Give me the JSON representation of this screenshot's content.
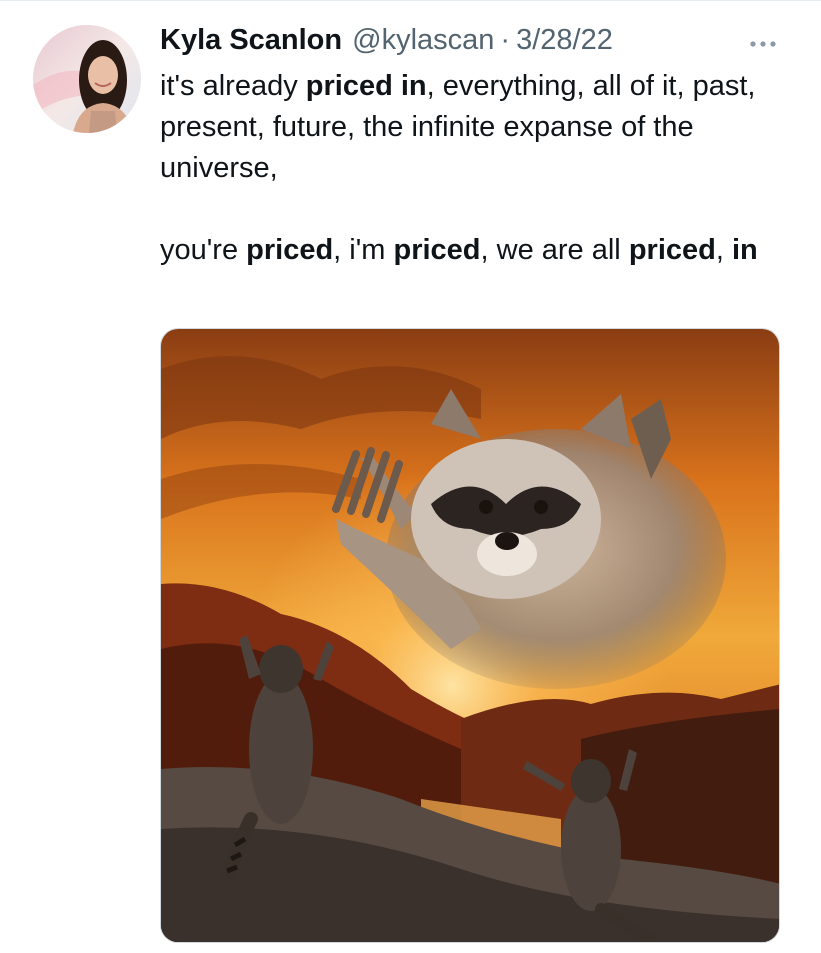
{
  "tweet": {
    "author_name": "Kyla Scanlon",
    "handle": "@kylascan",
    "separator": "·",
    "date": "3/28/22",
    "text_parts": [
      {
        "text": "it's already ",
        "bold": false
      },
      {
        "text": "priced in",
        "bold": true
      },
      {
        "text": ", everything, all of it, past, present, future, the infinite expanse of the universe,\n\nyou're ",
        "bold": false
      },
      {
        "text": "priced",
        "bold": true
      },
      {
        "text": ", i'm ",
        "bold": false
      },
      {
        "text": "priced",
        "bold": true
      },
      {
        "text": ", we are all ",
        "bold": false
      },
      {
        "text": "priced",
        "bold": true
      },
      {
        "text": ", ",
        "bold": false
      },
      {
        "text": "in",
        "bold": true
      }
    ],
    "more_icon": "more-horizontal-icon",
    "media_description_icon": "image"
  },
  "colors": {
    "text_primary": "#0f1419",
    "text_secondary": "#536471",
    "border": "#cfd9de"
  }
}
